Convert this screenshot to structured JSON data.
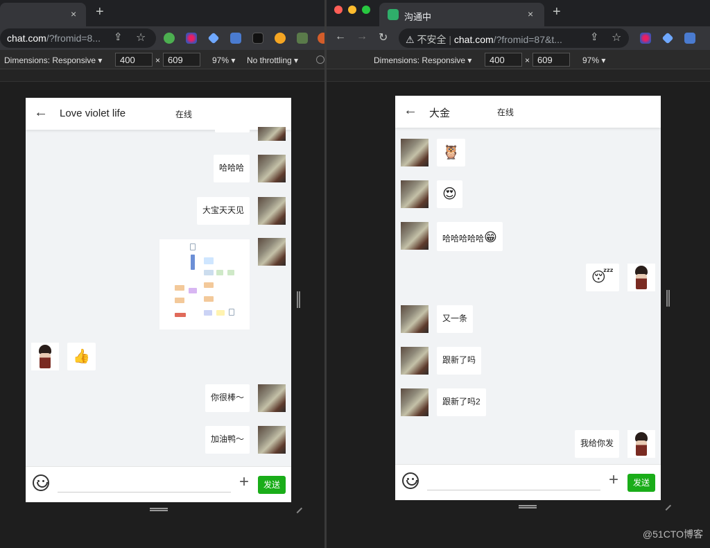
{
  "left": {
    "tab": {
      "title": "",
      "close": "×"
    },
    "new_tab": "+",
    "url": {
      "host": "chat.com",
      "rest": "/?fromid=8..."
    },
    "devtools": {
      "dimensions": "Dimensions: Responsive ▾",
      "width": "400",
      "times": "×",
      "height": "609",
      "zoom": "97% ▾",
      "throttle": "No throttling ▾"
    },
    "chat": {
      "back": "←",
      "name": "Love violet life",
      "status": "在线",
      "messages": [
        {
          "side": "right",
          "avatar": "landscape",
          "type": "text",
          "text": "哈哈哈"
        },
        {
          "side": "right",
          "avatar": "landscape",
          "type": "text",
          "text": "大宝天天见"
        },
        {
          "side": "right",
          "avatar": "landscape",
          "type": "image",
          "text": ""
        },
        {
          "side": "left",
          "avatar": "girl",
          "type": "emoji",
          "text": "👍"
        },
        {
          "side": "right",
          "avatar": "landscape",
          "type": "text",
          "text": "你很棒～"
        },
        {
          "side": "right",
          "avatar": "landscape",
          "type": "text",
          "text": "加油鸭～"
        }
      ],
      "send_label": "发送",
      "plus": "+"
    }
  },
  "right": {
    "tab": {
      "title": "沟通中",
      "close": "×"
    },
    "new_tab": "+",
    "url": {
      "insecure": "不安全",
      "host": "chat.com",
      "rest": "/?fromid=87&t..."
    },
    "devtools": {
      "dimensions": "Dimensions: Responsive ▾",
      "width": "400",
      "times": "×",
      "height": "609",
      "zoom": "97% ▾"
    },
    "chat": {
      "back": "←",
      "name": "大金",
      "status": "在线",
      "messages": [
        {
          "side": "left",
          "avatar": "landscape",
          "type": "emoji",
          "text": "🦉"
        },
        {
          "side": "left",
          "avatar": "landscape",
          "type": "emoji",
          "text": "😍"
        },
        {
          "side": "left",
          "avatar": "landscape",
          "type": "text",
          "text": "哈哈哈哈哈",
          "emoji": "😁"
        },
        {
          "side": "right",
          "avatar": "girl",
          "type": "emoji",
          "text": "😴"
        },
        {
          "side": "left",
          "avatar": "landscape",
          "type": "text",
          "text": "又一条"
        },
        {
          "side": "left",
          "avatar": "landscape",
          "type": "text",
          "text": "跟新了吗"
        },
        {
          "side": "left",
          "avatar": "landscape",
          "type": "text",
          "text": "跟新了吗2"
        },
        {
          "side": "right",
          "avatar": "girl",
          "type": "text",
          "text": "我给你发"
        }
      ],
      "send_label": "发送",
      "plus": "+"
    }
  },
  "watermark": "@51CTO博客",
  "colors": {
    "send": "#1aad19",
    "chrome_dark": "#202124",
    "toolbar": "#35363a",
    "chat_bg": "#f1f3f5"
  }
}
